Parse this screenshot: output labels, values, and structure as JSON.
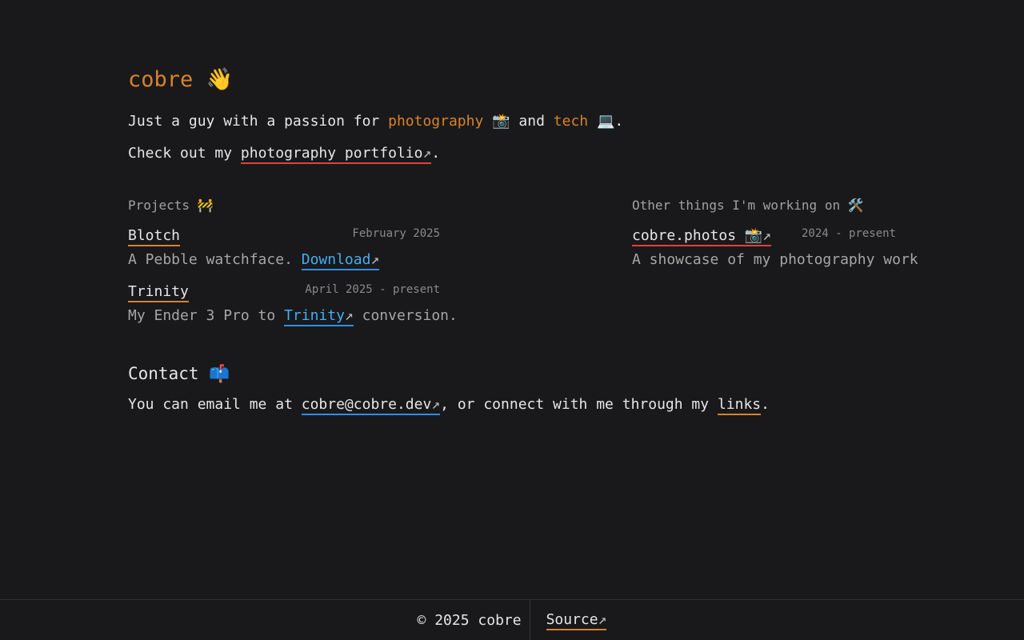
{
  "header": {
    "name": "cobre",
    "wave_emoji": "👋"
  },
  "bio": {
    "line1_prefix": "Just a guy with a passion for ",
    "photography": "photography",
    "camera_emoji": "📸",
    "and": " and ",
    "tech": "tech",
    "laptop_emoji": "💻",
    "period": ".",
    "line2_prefix": "Check out my ",
    "portfolio_link": "photography portfolio",
    "arrow": "↗",
    "line2_suffix": "."
  },
  "projects": {
    "heading": "Projects 🚧",
    "items": [
      {
        "name": "Blotch",
        "date": "February 2025",
        "desc_prefix": "A Pebble watchface. ",
        "desc_link": "Download",
        "desc_suffix": ""
      },
      {
        "name": "Trinity",
        "date": "April 2025 - present",
        "desc_prefix": "My Ender 3 Pro to ",
        "desc_link": "Trinity",
        "desc_suffix": " conversion."
      }
    ]
  },
  "other": {
    "heading": "Other things I'm working on 🛠️",
    "items": [
      {
        "name": "cobre.photos 📸",
        "date": "2024 - present",
        "desc": "A showcase of my photography work"
      }
    ]
  },
  "contact": {
    "heading": "Contact 📫",
    "text_prefix": "You can email me at ",
    "email": "cobre@cobre.dev",
    "text_middle": ", or connect with me through my ",
    "links": "links",
    "text_suffix": "."
  },
  "footer": {
    "copyright": "© 2025 cobre",
    "source": "Source"
  },
  "colors": {
    "background": "#19191b",
    "accent_orange": "#d9822b",
    "link_blue": "#41aef0",
    "underline_red": "#e2403a"
  }
}
